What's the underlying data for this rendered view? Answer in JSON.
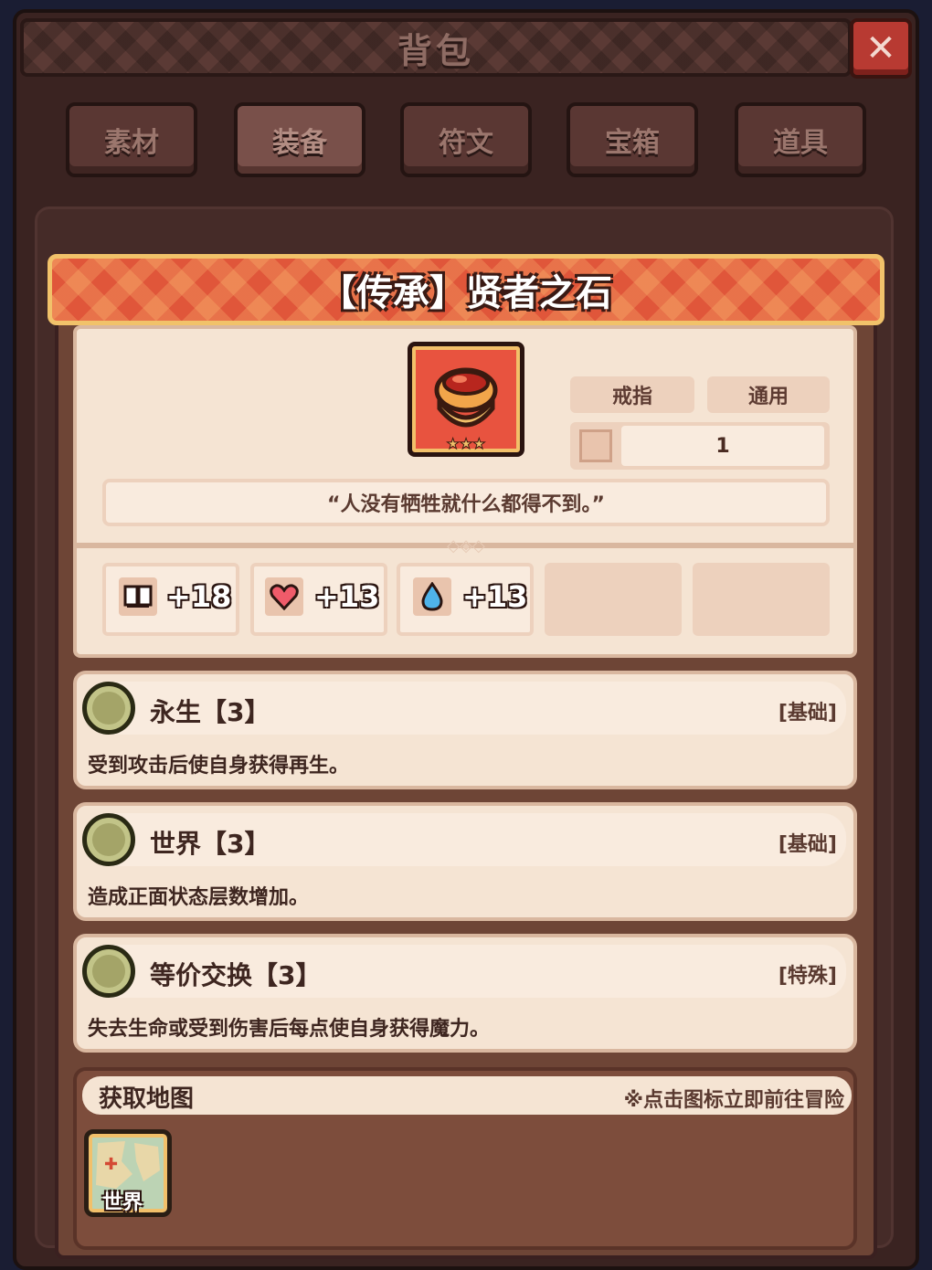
{
  "window": {
    "title": "背包",
    "close_label": "✕"
  },
  "tabs": [
    {
      "label": "素材",
      "active": false
    },
    {
      "label": "装备",
      "active": true
    },
    {
      "label": "符文",
      "active": false
    },
    {
      "label": "宝箱",
      "active": false
    },
    {
      "label": "道具",
      "active": false
    }
  ],
  "item": {
    "title": "【传承】贤者之石",
    "slot_type": "戒指",
    "class_type": "通用",
    "count": "1",
    "quote": "“人没有牺牲就什么都得不到。”",
    "stars": 3,
    "stats": [
      {
        "icon": "book-icon",
        "value": "+18"
      },
      {
        "icon": "heart-icon",
        "value": "+13"
      },
      {
        "icon": "water-drop-icon",
        "value": "+13"
      }
    ]
  },
  "skills": [
    {
      "name": "永生【3】",
      "tag": "[基础]",
      "desc": "受到攻击后使自身获得再生。"
    },
    {
      "name": "世界【3】",
      "tag": "[基础]",
      "desc": "造成正面状态层数增加。"
    },
    {
      "name": "等价交换【3】",
      "tag": "[特殊]",
      "desc": "失去生命或受到伤害后每点使自身获得魔力。"
    }
  ],
  "acquire": {
    "title": "获取地图",
    "hint": "※点击图标立即前往冒险",
    "maps": [
      {
        "label": "世界"
      }
    ]
  },
  "colors": {
    "accent": "#e0563a",
    "gold": "#f1c26a",
    "panel": "#f5e4d3",
    "frame": "#3a2321"
  }
}
